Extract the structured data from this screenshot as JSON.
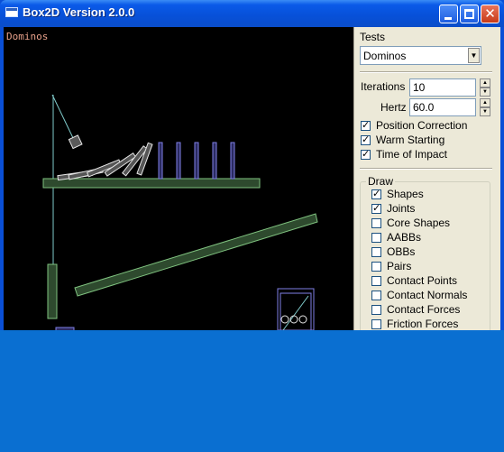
{
  "window": {
    "title": "Box2D Version 2.0.0"
  },
  "canvas": {
    "test_name": "Dominos"
  },
  "panel": {
    "tests_label": "Tests",
    "selected_test": "Dominos",
    "iterations_label": "Iterations",
    "iterations_value": "10",
    "hertz_label": "Hertz",
    "hertz_value": "60.0",
    "options": [
      {
        "label": "Position Correction",
        "checked": true
      },
      {
        "label": "Warm Starting",
        "checked": true
      },
      {
        "label": "Time of Impact",
        "checked": true
      }
    ],
    "draw_label": "Draw",
    "draw_options": [
      {
        "label": "Shapes",
        "checked": true
      },
      {
        "label": "Joints",
        "checked": true
      },
      {
        "label": "Core Shapes",
        "checked": false
      },
      {
        "label": "AABBs",
        "checked": false
      },
      {
        "label": "OBBs",
        "checked": false
      },
      {
        "label": "Pairs",
        "checked": false
      },
      {
        "label": "Contact Points",
        "checked": false
      },
      {
        "label": "Contact Normals",
        "checked": false
      },
      {
        "label": "Contact Forces",
        "checked": false
      },
      {
        "label": "Friction Forces",
        "checked": false
      }
    ]
  },
  "colors": {
    "titlebar": "#0a5ae8",
    "desktop": "#0a6fd1",
    "static_body": "#7fc27f",
    "dynamic_body": "#e6e6e6",
    "sleeping_body": "#8080e6",
    "joint": "#80cccc"
  }
}
